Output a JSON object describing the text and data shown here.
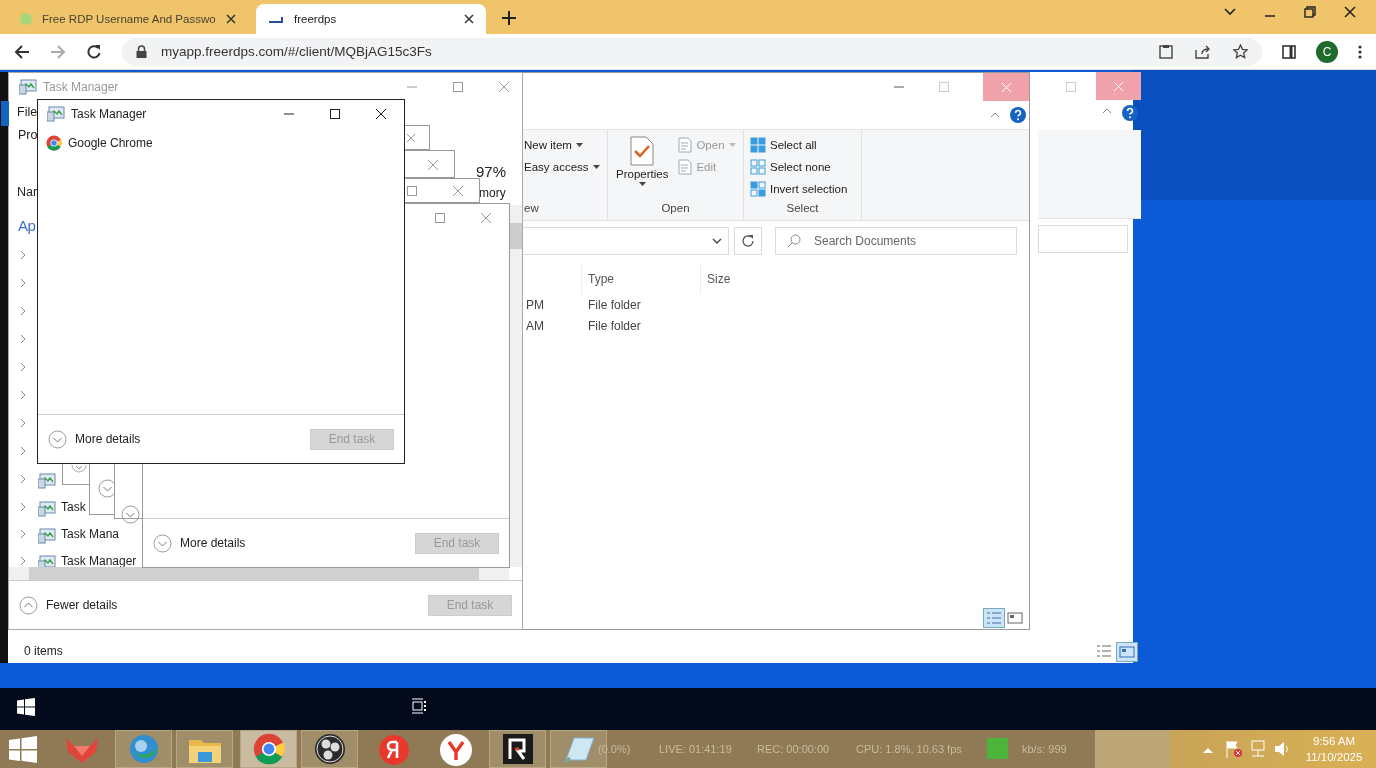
{
  "browser": {
    "tabs": [
      {
        "title": "Free RDP Username And Passwo",
        "selected": false
      },
      {
        "title": "freerdps",
        "selected": true
      }
    ],
    "address": "myapp.freerdps.com/#/client/MQBjAG15c3Fs",
    "profile_initial": "C"
  },
  "explorer_back": {
    "status": "0 items"
  },
  "explorer": {
    "ribbon_groups": [
      {
        "label": "ew",
        "items": [
          {
            "label": "New item",
            "disabled": false
          },
          {
            "label": "Easy access",
            "disabled": false
          }
        ]
      },
      {
        "label": "Open",
        "items": [
          {
            "label": "Properties",
            "disabled": false
          },
          {
            "label": "Open",
            "disabled": true
          },
          {
            "label": "Edit",
            "disabled": true
          }
        ]
      },
      {
        "label": "Select",
        "items": [
          {
            "label": "Select all",
            "disabled": false
          },
          {
            "label": "Select none",
            "disabled": false
          },
          {
            "label": "Invert selection",
            "disabled": false
          }
        ]
      }
    ],
    "search_placeholder": "Search Documents",
    "columns": [
      "Type",
      "Size"
    ],
    "rows": [
      {
        "modified": "PM",
        "type": "File folder"
      },
      {
        "modified": "AM",
        "type": "File folder"
      }
    ]
  },
  "task_manager_back": {
    "title": "Task Manager",
    "menu": "File",
    "tab": "Pro",
    "column_name": "Nar",
    "memory_percent": "97%",
    "memory_label": "mory",
    "section": "Ap",
    "rows": [
      "Task",
      "Task Mana",
      "Task Manager"
    ],
    "toggle": "Fewer details",
    "end_task": {
      "label": "End task",
      "disabled": true
    }
  },
  "task_manager_stack": {
    "toggle": "More details",
    "end_task": {
      "label": "End task",
      "disabled": true
    }
  },
  "task_manager_front": {
    "title": "Task Manager",
    "apps": [
      "Google Chrome"
    ],
    "toggle": "More details",
    "end_task": {
      "label": "End task",
      "disabled": true
    }
  },
  "host_taskbar": {
    "stats": [
      "(0.0%)",
      "LIVE: 01:41:19",
      "REC: 00:00:00",
      "CPU: 1.8%, 10.63 fps",
      "kb/s: 999"
    ],
    "time": "9:56 AM",
    "date": "11/10/2025"
  }
}
